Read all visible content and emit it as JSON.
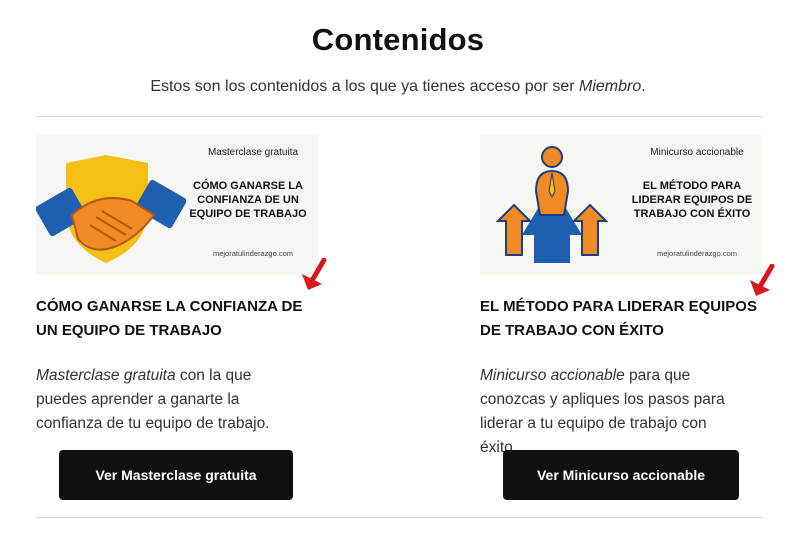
{
  "header": {
    "title": "Contenidos",
    "subtitle_prefix": "Estos son los contenidos a los que ya tienes acceso por ser ",
    "subtitle_emphasis": "Miembro",
    "subtitle_suffix": "."
  },
  "cards": [
    {
      "thumbnail": {
        "kicker": "Masterclase gratuita",
        "title": "CÓMO GANARSE LA CONFIANZA DE UN EQUIPO DE TRABAJO",
        "site": "mejoratulinderazgo.com",
        "icon": "handshake-shield-icon"
      },
      "title": "CÓMO GANARSE LA CONFIANZA DE UN EQUIPO DE TRABAJO",
      "desc_emphasis": "Masterclase gratuita",
      "desc_rest": " con la que puedes aprender a ganarte la confianza de tu equipo de trabajo.",
      "button_label": "Ver Masterclase gratuita"
    },
    {
      "thumbnail": {
        "kicker": "Minicurso accionable",
        "title": "EL MÉTODO PARA LIDERAR EQUIPOS DE TRABAJO CON ÉXITO",
        "site": "mejoratulinderazgo.com",
        "icon": "leader-arrows-icon"
      },
      "title": "EL MÉTODO PARA LIDERAR EQUIPOS DE TRABAJO CON ÉXITO",
      "desc_emphasis": "Minicurso accionable",
      "desc_rest": " para que conozcas y apliques los pasos para liderar a tu equipo de trabajo con éxito.",
      "button_label": "Ver Minicurso accionable"
    }
  ],
  "colors": {
    "accent_red": "#d7191c",
    "button_bg": "#111111",
    "shield_yellow": "#f5bf14",
    "hand_orange": "#f08a24",
    "sleeve_blue": "#1f5fb0"
  }
}
